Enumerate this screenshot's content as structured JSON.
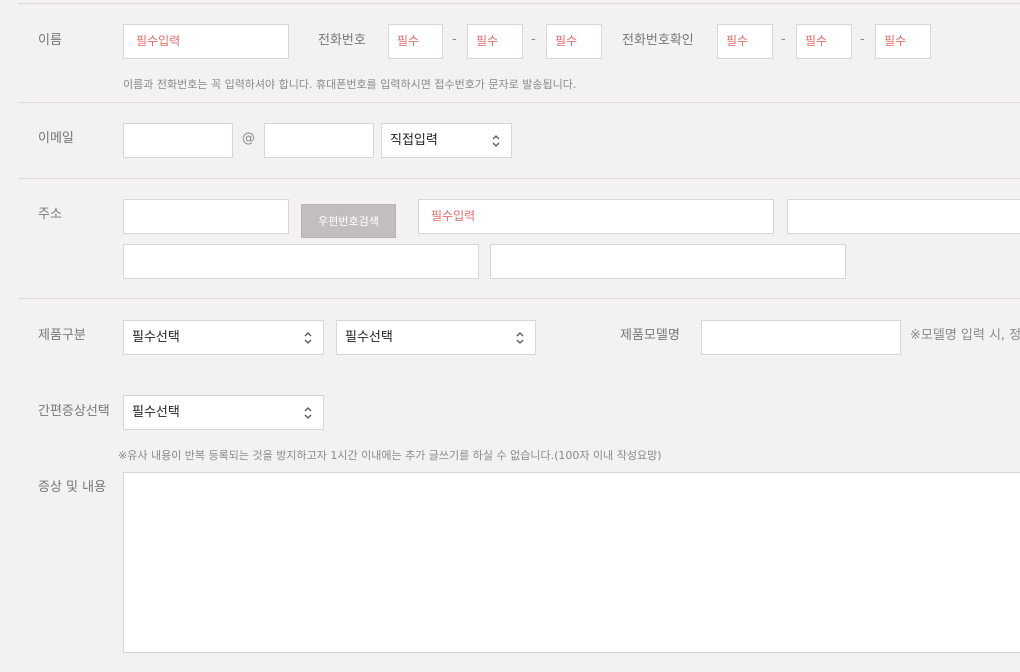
{
  "name_row": {
    "label": "이름",
    "name_placeholder": "필수입력",
    "phone_label": "전화번호",
    "phone_parts": [
      "필수",
      "필수",
      "필수"
    ],
    "phone_confirm_label": "전화번호확인",
    "phone_confirm_parts": [
      "필수",
      "필수",
      "필수"
    ],
    "dash": "-",
    "note": "이름과 전화번호는 꼭 입력하셔야 합니다. 휴대폰번호를 입력하시면 접수번호가 문자로 발송됩니다."
  },
  "email_row": {
    "label": "이메일",
    "at": "@",
    "domain_select": "직접입력"
  },
  "address_row": {
    "label": "주소",
    "zip_button": "우편번호검색",
    "address_placeholder": "필수입력"
  },
  "product_row": {
    "label": "제품구분",
    "select1": "필수선택",
    "select2": "필수선택",
    "model_label": "제품모델명",
    "model_note": "※모델명 입력 시, 정"
  },
  "symptom_row": {
    "label": "간편증상선택",
    "select": "필수선택",
    "note": "※유사 내용이 반복 등록되는 것을 방지하고자 1시간 이내에는 추가 글쓰기를 하실 수 없습니다.(100자 이내 작성요망)"
  },
  "content_row": {
    "label": "증상 및 내용"
  },
  "colors": {
    "background": "#f4f1f2",
    "required_text": "#e56b6b",
    "button_bg": "#c4bdbe"
  }
}
